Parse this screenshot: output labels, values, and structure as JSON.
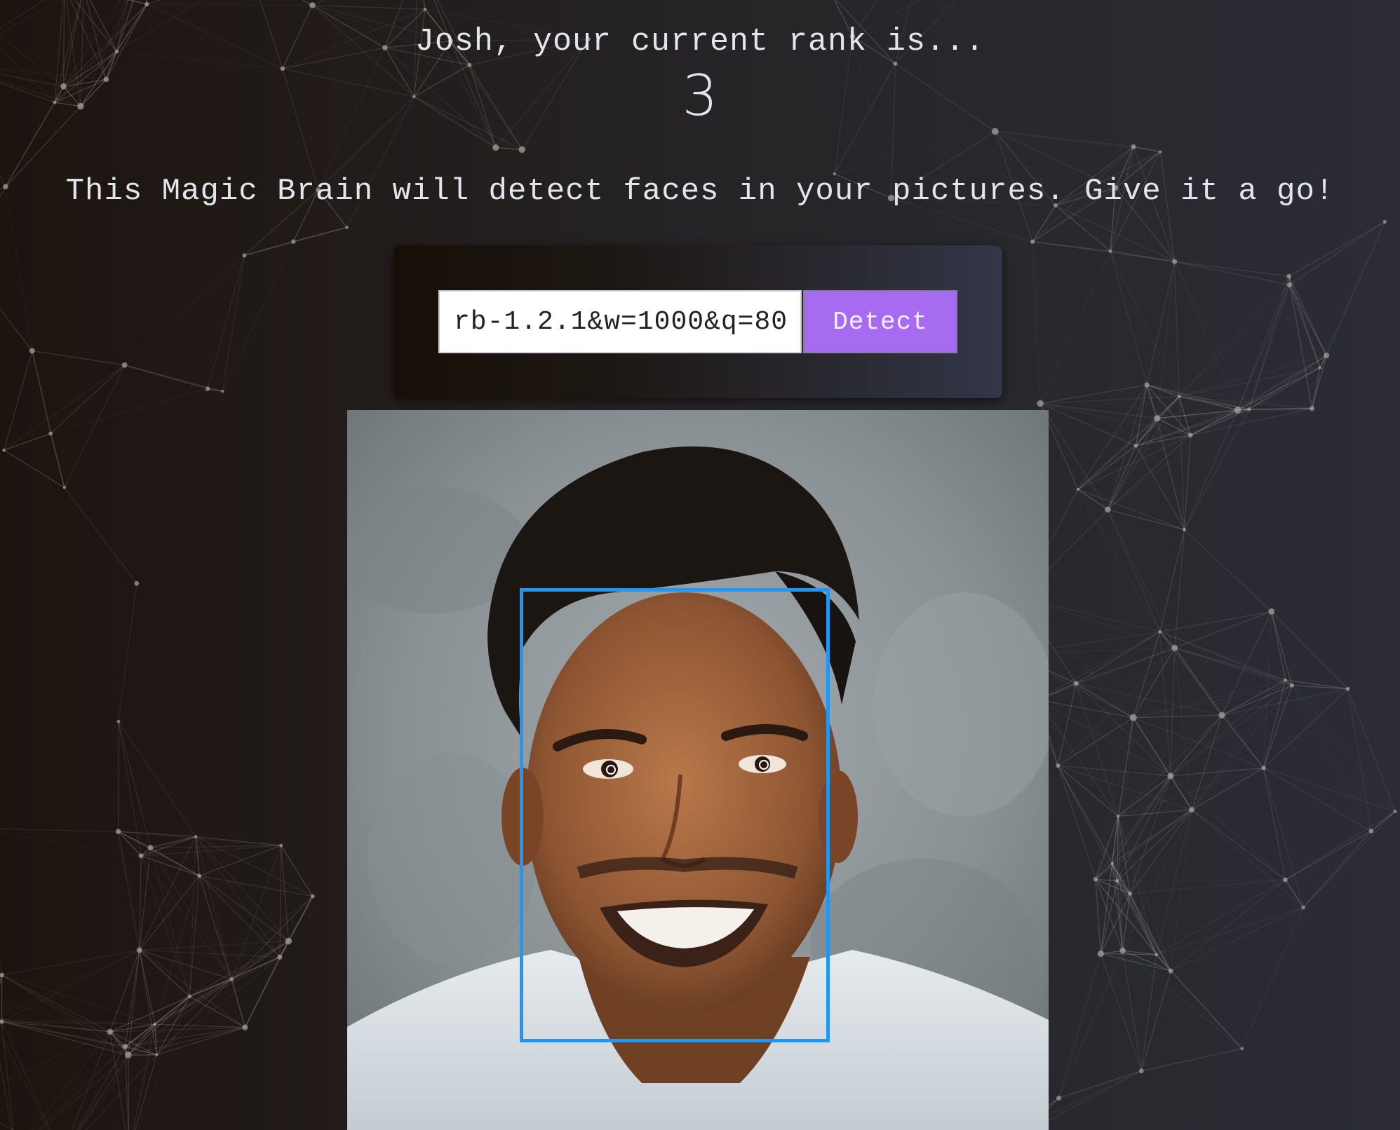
{
  "header": {
    "rank_message": "Josh, your current rank is...",
    "rank_value": "3"
  },
  "intro": {
    "text": "This Magic Brain will detect faces in your pictures. Give it a go!"
  },
  "form": {
    "url_value": "rb-1.2.1&w=1000&q=80",
    "detect_label": "Detect"
  },
  "colors": {
    "button_accent": "#a66bf0",
    "face_box": "#2196f3"
  }
}
